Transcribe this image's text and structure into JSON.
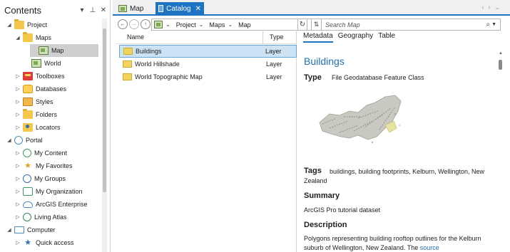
{
  "contents": {
    "title": "Contents",
    "items": [
      {
        "label": "Project",
        "arrow": "◢",
        "icon": "project-folder-icon"
      },
      {
        "label": "Maps",
        "arrow": "◢",
        "icon": "maps-folder-icon"
      },
      {
        "label": "Map",
        "arrow": "",
        "icon": "map-icon"
      },
      {
        "label": "World",
        "arrow": "",
        "icon": "map-icon"
      },
      {
        "label": "Toolboxes",
        "arrow": "▷",
        "icon": "toolbox-icon"
      },
      {
        "label": "Databases",
        "arrow": "▷",
        "icon": "database-icon"
      },
      {
        "label": "Styles",
        "arrow": "▷",
        "icon": "styles-icon"
      },
      {
        "label": "Folders",
        "arrow": "▷",
        "icon": "folders-icon"
      },
      {
        "label": "Locators",
        "arrow": "▷",
        "icon": "locators-icon"
      },
      {
        "label": "Portal",
        "arrow": "◢",
        "icon": "portal-icon"
      },
      {
        "label": "My Content",
        "arrow": "▷",
        "icon": "my-content-icon"
      },
      {
        "label": "My Favorites",
        "arrow": "▷",
        "icon": "favorites-icon"
      },
      {
        "label": "My Groups",
        "arrow": "▷",
        "icon": "groups-icon"
      },
      {
        "label": "My Organization",
        "arrow": "▷",
        "icon": "organization-icon"
      },
      {
        "label": "ArcGIS Enterprise",
        "arrow": "▷",
        "icon": "enterprise-icon"
      },
      {
        "label": "Living Atlas",
        "arrow": "▷",
        "icon": "living-atlas-icon"
      },
      {
        "label": "Computer",
        "arrow": "◢",
        "icon": "computer-icon"
      },
      {
        "label": "Quick access",
        "arrow": "▷",
        "icon": "quick-access-icon"
      }
    ]
  },
  "tabs": {
    "map_label": "Map",
    "catalog_label": "Catalog"
  },
  "nav": {
    "breadcrumb": [
      "Project",
      "Maps",
      "Map"
    ],
    "search_placeholder": "Search Map"
  },
  "filelist": {
    "col_name": "Name",
    "col_type": "Type",
    "rows": [
      {
        "name": "Buildings",
        "type": "Layer"
      },
      {
        "name": "World Hillshade",
        "type": "Layer"
      },
      {
        "name": "World Topographic Map",
        "type": "Layer"
      }
    ]
  },
  "details": {
    "tabs": [
      "Metadata",
      "Geography",
      "Table"
    ],
    "title": "Buildings",
    "type_label": "Type",
    "type_value": "File Geodatabase Feature Class",
    "tags_label": "Tags",
    "tags_value": "buildings, building footprints, Kelburn, Wellington, New Zealand",
    "summary_label": "Summary",
    "summary_value": "ArcGIS Pro tutorial dataset",
    "description_label": "Description",
    "description_value": "Polygons representing building rooftop outlines for the Kelburn suburb of Wellington, New Zealand. The",
    "description_link": "source"
  },
  "colors": {
    "accent": "#1f73c5",
    "selection": "#cce3f5",
    "link": "#1f6fb8"
  }
}
